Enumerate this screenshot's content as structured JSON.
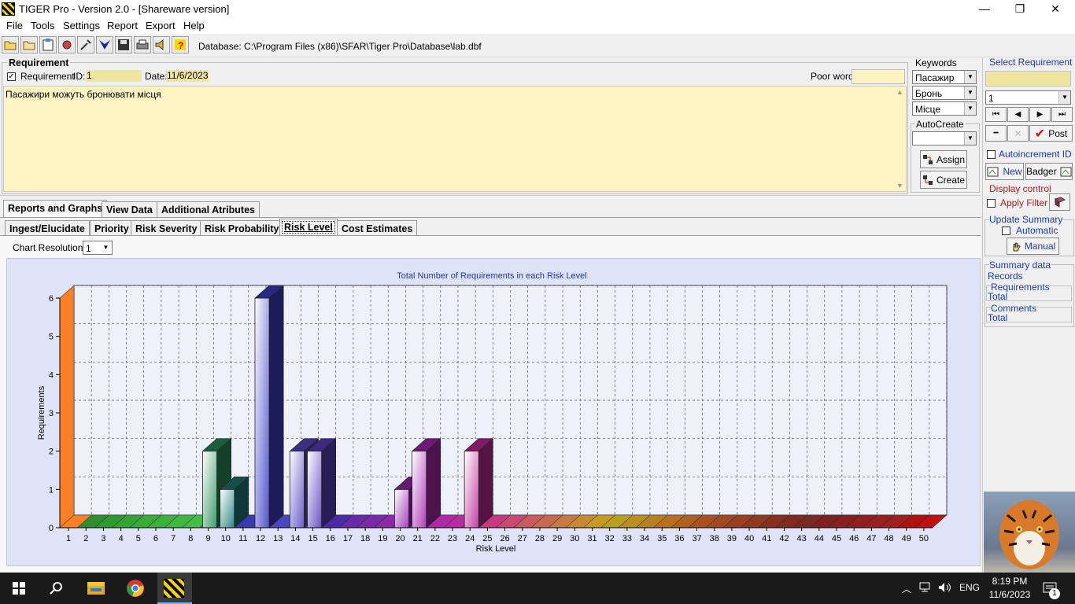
{
  "window": {
    "title": "TIGER Pro - Version 2.0 - [Shareware version]",
    "minimize_glyph": "—",
    "maximize_glyph": "❐",
    "close_glyph": "✕"
  },
  "menu": [
    "File",
    "Tools",
    "Settings",
    "Report",
    "Export",
    "Help"
  ],
  "toolbar": {
    "database_path": "Database: C:\\Program Files (x86)\\SFAR\\Tiger Pro\\Database\\lab.dbf"
  },
  "requirement": {
    "group_title": "Requirement",
    "checkbox_label": "Requirement",
    "checkbox_glyph": "✓",
    "id_label": "ID:",
    "id_value": "1",
    "date_label": "Date:",
    "date_value": "11/6/2023",
    "poor_word_label": "Poor word:",
    "poor_word_value": "",
    "text": "Пасажири можуть бронювати місця"
  },
  "keywords": {
    "title": "Keywords",
    "items": [
      "Пасажир",
      "Бронь",
      "Місце"
    ]
  },
  "autocreate": {
    "title": "AutoCreate",
    "value": "",
    "assign_label": "Assign",
    "create_label": "Create"
  },
  "tabs_main": [
    "Reports and Graphs",
    "View Data",
    "Additional Atributes"
  ],
  "tabs_sub": [
    "Ingest/Elucidate",
    "Priority",
    "Risk Severity",
    "Risk Probability",
    "Risk Level",
    "Cost Estimates"
  ],
  "chart_resolution": {
    "label": "Chart Resolution:",
    "value": "1"
  },
  "select_requirement": {
    "title": "Select Requirement",
    "search_value": "",
    "selected": "1",
    "nav": [
      "⏮",
      "◀",
      "▶",
      "⏭"
    ],
    "minus_glyph": "━",
    "cancel_glyph": "✕",
    "post_glyph": "✔",
    "post_label": "Post",
    "autoincrement_label": "Autoincrement ID",
    "new_label": "New",
    "badger_label": "Badger"
  },
  "display_control": {
    "title": "Display control",
    "apply_filter_label": "Apply Filter"
  },
  "update_summary": {
    "title": "Update Summary",
    "automatic_label": "Automatic",
    "manual_label": "Manual"
  },
  "summary_data": {
    "title": "Summary data",
    "records_label": "Records",
    "requirements_label": "Requirements",
    "requirements_total": "Total",
    "comments_label": "Comments",
    "comments_total": "Total"
  },
  "taskbar": {
    "time": "8:19 PM",
    "date": "11/6/2023",
    "lang": "ENG",
    "notifications": "1"
  },
  "chart_data": {
    "type": "bar",
    "title": "Total Number of Requirements in each Risk Level",
    "xlabel": "Risk Level",
    "ylabel": "Requirements",
    "ylim": [
      0,
      6
    ],
    "yticks": [
      "0",
      "1",
      "2",
      "3",
      "4",
      "5",
      "6"
    ],
    "grid": true,
    "categories": [
      "1",
      "2",
      "3",
      "4",
      "5",
      "6",
      "7",
      "8",
      "9",
      "10",
      "11",
      "12",
      "13",
      "14",
      "15",
      "16",
      "17",
      "18",
      "19",
      "20",
      "21",
      "22",
      "23",
      "24",
      "25",
      "26",
      "27",
      "28",
      "29",
      "30",
      "31",
      "32",
      "33",
      "34",
      "35",
      "36",
      "37",
      "38",
      "39",
      "40",
      "41",
      "42",
      "43",
      "44",
      "45",
      "46",
      "47",
      "48",
      "49",
      "50"
    ],
    "values": [
      0,
      0,
      0,
      0,
      0,
      0,
      0,
      0,
      2,
      1,
      0,
      6,
      0,
      2,
      2,
      0,
      0,
      0,
      0,
      1,
      2,
      0,
      0,
      2,
      0,
      0,
      0,
      0,
      0,
      0,
      0,
      0,
      0,
      0,
      0,
      0,
      0,
      0,
      0,
      0,
      0,
      0,
      0,
      0,
      0,
      0,
      0,
      0,
      0,
      0
    ],
    "colors": [
      "#ff7f27",
      "#2f8f2f",
      "#2f9a2f",
      "#34a334",
      "#38ab38",
      "#3cb23c",
      "#40b840",
      "#44be44",
      "#2e8f5a",
      "#1f7a7a",
      "#3a3ab5",
      "#3f3fc8",
      "#4a48c0",
      "#5a4ac4",
      "#5a40c0",
      "#4a2aa8",
      "#6a2aa8",
      "#7a2aa8",
      "#8a2aa8",
      "#9a2ab0",
      "#a82ab0",
      "#b02aa8",
      "#b82aa0",
      "#c02a98",
      "#c83a80",
      "#c84a70",
      "#c85a60",
      "#c86a50",
      "#c87a40",
      "#c88a30",
      "#c89a20",
      "#b8a020",
      "#b89020",
      "#b88020",
      "#b87020",
      "#b06020",
      "#a85020",
      "#a04a20",
      "#984020",
      "#903a20",
      "#883020",
      "#802a20",
      "#782a20",
      "#802020",
      "#882020",
      "#902020",
      "#982020",
      "#a02020",
      "#b01010",
      "#c01010"
    ]
  }
}
